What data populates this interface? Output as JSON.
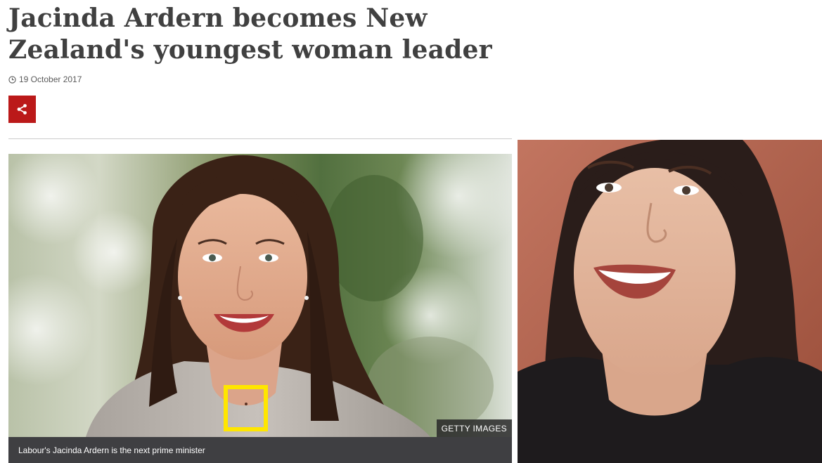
{
  "article": {
    "headline": "Jacinda Ardern becomes New Zealand's youngest woman leader",
    "date": "19 October 2017",
    "share_icon": "share-icon",
    "clock_icon": "clock-icon"
  },
  "main_image": {
    "credit": "GETTY IMAGES",
    "caption": "Labour's Jacinda Ardern is the next prime minister",
    "annotation_color": "#ffe600"
  },
  "colors": {
    "share_button": "#bb1919",
    "caption_bar": "#3f3f42",
    "headline_text": "#404040"
  }
}
